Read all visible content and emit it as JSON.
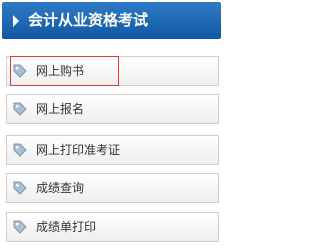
{
  "header": {
    "title": "会计从业资格考试",
    "arrow_icon": "triangle-right-icon"
  },
  "menu": {
    "items": [
      {
        "label": "网上购书",
        "icon": "tag-icon",
        "highlighted": true
      },
      {
        "label": "网上报名",
        "icon": "tag-icon"
      },
      {
        "label": "网上打印准考证",
        "icon": "tag-icon"
      },
      {
        "label": "成绩查询",
        "icon": "tag-icon"
      },
      {
        "label": "成绩单打印",
        "icon": "tag-icon"
      }
    ]
  },
  "colors": {
    "header_bg": "#1a66b3",
    "item_border": "#cfcfcf",
    "highlight_border": "#e03a3a",
    "icon_fill": "#a9bfd3"
  }
}
